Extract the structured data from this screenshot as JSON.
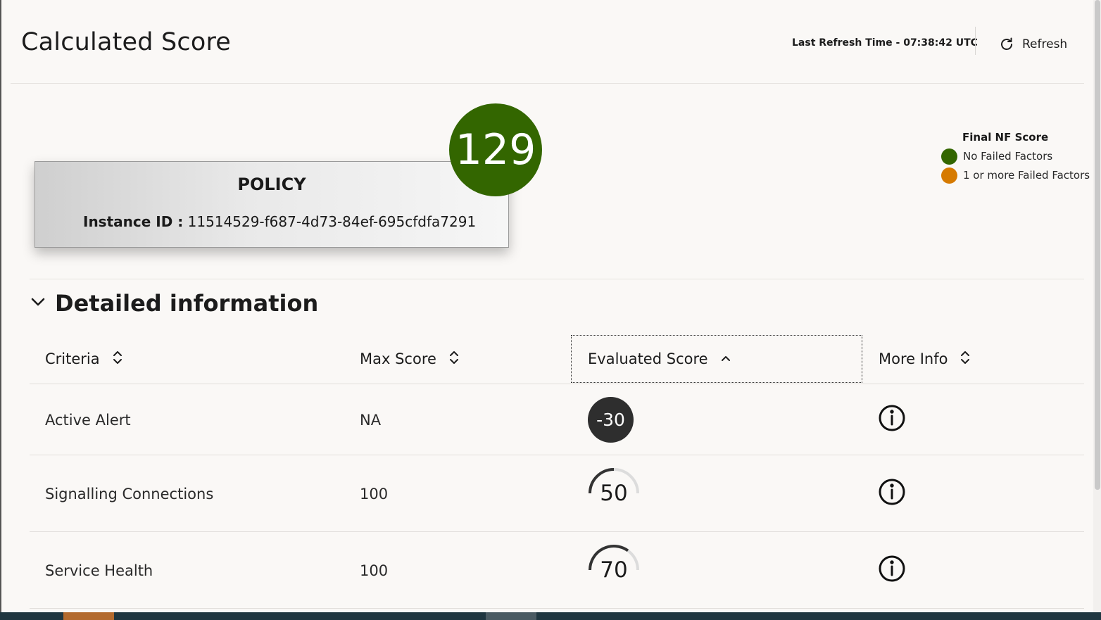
{
  "header": {
    "title": "Calculated Score",
    "last_refresh": "Last Refresh Time - 07:38:42 UTC",
    "refresh_label": "Refresh"
  },
  "policy": {
    "title": "POLICY",
    "instance_label": "Instance ID :",
    "instance_id": "11514529-f687-4d73-84ef-695cfdfa7291",
    "score": "129",
    "score_color": "#336600"
  },
  "legend": {
    "title": "Final NF Score",
    "items": [
      {
        "label": "No Failed Factors",
        "color": "#336600"
      },
      {
        "label": "1 or more Failed Factors",
        "color": "#d67a00"
      }
    ]
  },
  "details": {
    "section_title": "Detailed information",
    "columns": [
      {
        "label": "Criteria",
        "sort": "sortable"
      },
      {
        "label": "Max Score",
        "sort": "sortable"
      },
      {
        "label": "Evaluated Score",
        "sort": "ascending"
      },
      {
        "label": "More Info",
        "sort": "sortable"
      }
    ],
    "rows": [
      {
        "criteria": "Active Alert",
        "max_score": "NA",
        "evaluated_score": "-30",
        "display": "badge"
      },
      {
        "criteria": "Signalling Connections",
        "max_score": "100",
        "evaluated_score": "50",
        "display": "gauge",
        "fraction": 0.5
      },
      {
        "criteria": "Service Health",
        "max_score": "100",
        "evaluated_score": "70",
        "display": "gauge",
        "fraction": 0.7
      }
    ]
  }
}
